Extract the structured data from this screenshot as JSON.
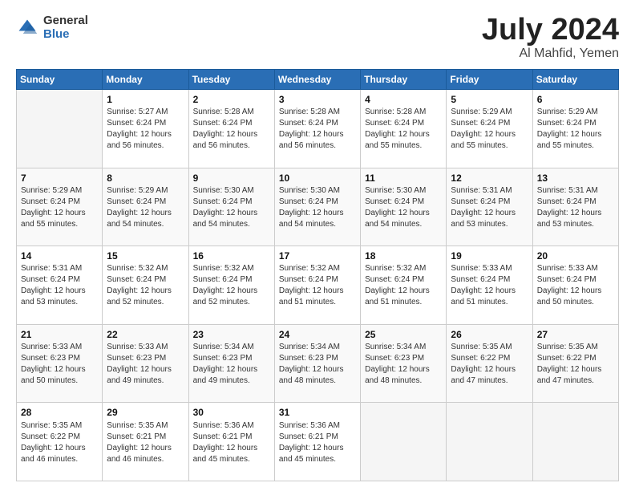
{
  "logo": {
    "general": "General",
    "blue": "Blue"
  },
  "title": {
    "month_year": "July 2024",
    "location": "Al Mahfid, Yemen"
  },
  "header_days": [
    "Sunday",
    "Monday",
    "Tuesday",
    "Wednesday",
    "Thursday",
    "Friday",
    "Saturday"
  ],
  "weeks": [
    [
      {
        "day": "",
        "info": ""
      },
      {
        "day": "1",
        "info": "Sunrise: 5:27 AM\nSunset: 6:24 PM\nDaylight: 12 hours\nand 56 minutes."
      },
      {
        "day": "2",
        "info": "Sunrise: 5:28 AM\nSunset: 6:24 PM\nDaylight: 12 hours\nand 56 minutes."
      },
      {
        "day": "3",
        "info": "Sunrise: 5:28 AM\nSunset: 6:24 PM\nDaylight: 12 hours\nand 56 minutes."
      },
      {
        "day": "4",
        "info": "Sunrise: 5:28 AM\nSunset: 6:24 PM\nDaylight: 12 hours\nand 55 minutes."
      },
      {
        "day": "5",
        "info": "Sunrise: 5:29 AM\nSunset: 6:24 PM\nDaylight: 12 hours\nand 55 minutes."
      },
      {
        "day": "6",
        "info": "Sunrise: 5:29 AM\nSunset: 6:24 PM\nDaylight: 12 hours\nand 55 minutes."
      }
    ],
    [
      {
        "day": "7",
        "info": "Sunrise: 5:29 AM\nSunset: 6:24 PM\nDaylight: 12 hours\nand 55 minutes."
      },
      {
        "day": "8",
        "info": "Sunrise: 5:29 AM\nSunset: 6:24 PM\nDaylight: 12 hours\nand 54 minutes."
      },
      {
        "day": "9",
        "info": "Sunrise: 5:30 AM\nSunset: 6:24 PM\nDaylight: 12 hours\nand 54 minutes."
      },
      {
        "day": "10",
        "info": "Sunrise: 5:30 AM\nSunset: 6:24 PM\nDaylight: 12 hours\nand 54 minutes."
      },
      {
        "day": "11",
        "info": "Sunrise: 5:30 AM\nSunset: 6:24 PM\nDaylight: 12 hours\nand 54 minutes."
      },
      {
        "day": "12",
        "info": "Sunrise: 5:31 AM\nSunset: 6:24 PM\nDaylight: 12 hours\nand 53 minutes."
      },
      {
        "day": "13",
        "info": "Sunrise: 5:31 AM\nSunset: 6:24 PM\nDaylight: 12 hours\nand 53 minutes."
      }
    ],
    [
      {
        "day": "14",
        "info": "Sunrise: 5:31 AM\nSunset: 6:24 PM\nDaylight: 12 hours\nand 53 minutes."
      },
      {
        "day": "15",
        "info": "Sunrise: 5:32 AM\nSunset: 6:24 PM\nDaylight: 12 hours\nand 52 minutes."
      },
      {
        "day": "16",
        "info": "Sunrise: 5:32 AM\nSunset: 6:24 PM\nDaylight: 12 hours\nand 52 minutes."
      },
      {
        "day": "17",
        "info": "Sunrise: 5:32 AM\nSunset: 6:24 PM\nDaylight: 12 hours\nand 51 minutes."
      },
      {
        "day": "18",
        "info": "Sunrise: 5:32 AM\nSunset: 6:24 PM\nDaylight: 12 hours\nand 51 minutes."
      },
      {
        "day": "19",
        "info": "Sunrise: 5:33 AM\nSunset: 6:24 PM\nDaylight: 12 hours\nand 51 minutes."
      },
      {
        "day": "20",
        "info": "Sunrise: 5:33 AM\nSunset: 6:24 PM\nDaylight: 12 hours\nand 50 minutes."
      }
    ],
    [
      {
        "day": "21",
        "info": "Sunrise: 5:33 AM\nSunset: 6:23 PM\nDaylight: 12 hours\nand 50 minutes."
      },
      {
        "day": "22",
        "info": "Sunrise: 5:33 AM\nSunset: 6:23 PM\nDaylight: 12 hours\nand 49 minutes."
      },
      {
        "day": "23",
        "info": "Sunrise: 5:34 AM\nSunset: 6:23 PM\nDaylight: 12 hours\nand 49 minutes."
      },
      {
        "day": "24",
        "info": "Sunrise: 5:34 AM\nSunset: 6:23 PM\nDaylight: 12 hours\nand 48 minutes."
      },
      {
        "day": "25",
        "info": "Sunrise: 5:34 AM\nSunset: 6:23 PM\nDaylight: 12 hours\nand 48 minutes."
      },
      {
        "day": "26",
        "info": "Sunrise: 5:35 AM\nSunset: 6:22 PM\nDaylight: 12 hours\nand 47 minutes."
      },
      {
        "day": "27",
        "info": "Sunrise: 5:35 AM\nSunset: 6:22 PM\nDaylight: 12 hours\nand 47 minutes."
      }
    ],
    [
      {
        "day": "28",
        "info": "Sunrise: 5:35 AM\nSunset: 6:22 PM\nDaylight: 12 hours\nand 46 minutes."
      },
      {
        "day": "29",
        "info": "Sunrise: 5:35 AM\nSunset: 6:21 PM\nDaylight: 12 hours\nand 46 minutes."
      },
      {
        "day": "30",
        "info": "Sunrise: 5:36 AM\nSunset: 6:21 PM\nDaylight: 12 hours\nand 45 minutes."
      },
      {
        "day": "31",
        "info": "Sunrise: 5:36 AM\nSunset: 6:21 PM\nDaylight: 12 hours\nand 45 minutes."
      },
      {
        "day": "",
        "info": ""
      },
      {
        "day": "",
        "info": ""
      },
      {
        "day": "",
        "info": ""
      }
    ]
  ]
}
